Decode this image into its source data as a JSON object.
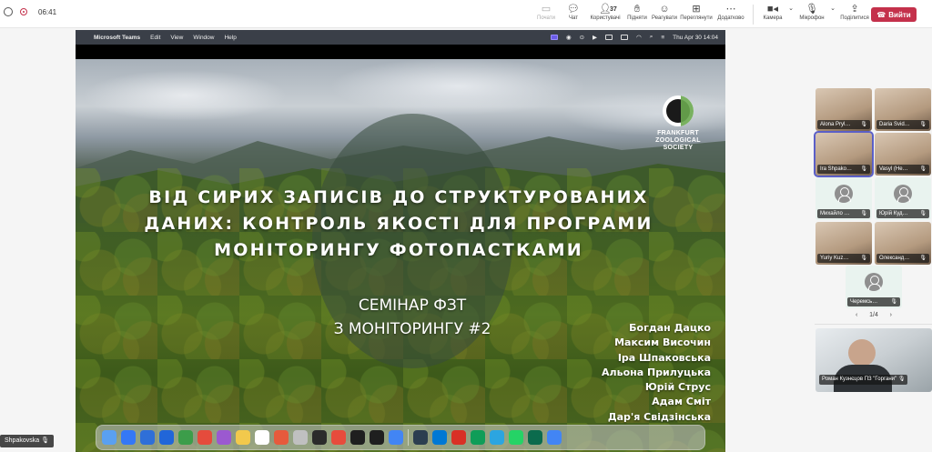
{
  "meeting": {
    "timer": "06:41",
    "toolbar": {
      "start": "Почати",
      "chat": "Чат",
      "people": "Користувачі",
      "people_count": "37",
      "raise": "Підняти",
      "react": "Реагувати",
      "view": "Переглянути",
      "apps": "Додатково",
      "camera": "Камера",
      "mic": "Мікрофон",
      "share": "Поділитися",
      "leave": "Вийти"
    }
  },
  "mac_menubar": {
    "app_name": "Microsoft Teams",
    "menus": [
      "Edit",
      "View",
      "Window",
      "Help"
    ],
    "clock": "Thu Apr 30  14:04"
  },
  "slide": {
    "logo_text_1": "FRANKFURT",
    "logo_text_2": "ZOOLOGICAL",
    "logo_text_3": "SOCIETY",
    "title_line1": "ВІД СИРИХ ЗАПИСІВ ДО СТРУКТУРОВАНИХ",
    "title_line2": "ДАНИХ: КОНТРОЛЬ ЯКОСТІ ДЛЯ ПРОГРАМИ",
    "title_line3": "МОНІТОРИНГУ ФОТОПАСТКАМИ",
    "subtitle_line1": "СЕМІНАР ФЗТ",
    "subtitle_line2": "З МОНІТОРИНГУ #2",
    "authors": [
      "Богдан Дацко",
      "Максим Височин",
      "Іра Шпаковська",
      "Альона Прилуцька",
      "Юрій Струс",
      "Адам Сміт",
      "Дар'я Свідзінська"
    ]
  },
  "presenter_label": "Shpakovska",
  "participants": [
    {
      "name": "Alona Pryl…",
      "type": "video"
    },
    {
      "name": "Daria Svid…",
      "type": "video"
    },
    {
      "name": "Ira Shpako…",
      "type": "video"
    },
    {
      "name": "Vasyl (He…",
      "type": "video"
    },
    {
      "name": "Михайло …",
      "type": "placeholder"
    },
    {
      "name": "Юрій Куд…",
      "type": "placeholder"
    },
    {
      "name": "Yuriy Kuz…",
      "type": "video"
    },
    {
      "name": "Олександ…",
      "type": "video"
    },
    {
      "name": "Черемсь…",
      "type": "placeholder"
    }
  ],
  "pager": {
    "label": "1/4"
  },
  "spotlight": {
    "name": "Роман Кузнєцов ПЗ \"Горгани\""
  },
  "dock_colors": [
    "#5aa0f0",
    "#3478f6",
    "#2f6fd8",
    "#2166d9",
    "#3c9d4a",
    "#e54b3c",
    "#9b59d0",
    "#f2c94c",
    "#ffffff",
    "#e65a3c",
    "#c0c0c0",
    "#2b2b2b",
    "#e74c3c",
    "#1f1f1f",
    "#1f1f1f",
    "#4285f4",
    "#2c3e50",
    "#0078d4",
    "#d93025",
    "#0f9d58",
    "#2ca5e0",
    "#25d366",
    "#0b6b4d",
    "#4285f4"
  ]
}
